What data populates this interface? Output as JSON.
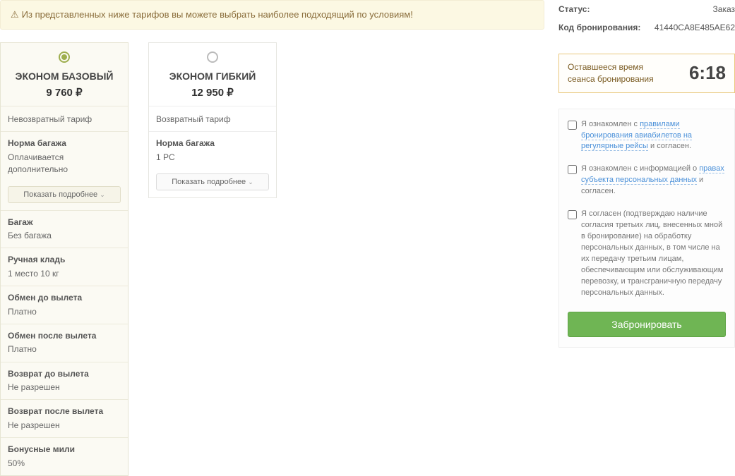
{
  "banner": {
    "text": "Из представленных ниже тарифов вы можете выбрать наиболее подходящий по условиям!"
  },
  "tariffs": {
    "show_more_label": "Показать подробнее",
    "basic": {
      "name": "ЭКОНОМ БАЗОВЫЙ",
      "price": "9 760",
      "currency": "₽",
      "refund_type": "Невозвратный тариф",
      "baggage_norm_label": "Норма багажа",
      "baggage_norm_value": "Оплачивается дополнительно",
      "baggage_label": "Багаж",
      "baggage_value": "Без багажа",
      "carry_label": "Ручная кладь",
      "carry_value": "1 место 10 кг",
      "exchange_before_label": "Обмен до вылета",
      "exchange_before_value": "Платно",
      "exchange_after_label": "Обмен после вылета",
      "exchange_after_value": "Платно",
      "refund_before_label": "Возврат до вылета",
      "refund_before_value": "Не разрешен",
      "refund_after_label": "Возврат после вылета",
      "refund_after_value": "Не разрешен",
      "miles_label": "Бонусные мили",
      "miles_value": "50%"
    },
    "flex": {
      "name": "ЭКОНОМ ГИБКИЙ",
      "price": "12 950",
      "currency": "₽",
      "refund_type": "Возвратный тариф",
      "baggage_norm_label": "Норма багажа",
      "baggage_norm_value": "1 PC"
    }
  },
  "sidebar": {
    "status_label": "Статус:",
    "status_value": "Заказ",
    "code_label": "Код бронирования:",
    "code_value": "41440CA8E485AE62",
    "timer_label": "Оставшееся время сеанса бронирования",
    "timer_value": "6:18",
    "agree1_pre": "Я ознакомлен с ",
    "agree1_link": "правилами бронирования авиабилетов на регулярные рейсы",
    "agree1_post": " и согласен.",
    "agree2_pre": "Я ознакомлен с информацией о ",
    "agree2_link": "правах субъекта персональных данных",
    "agree2_post": " и согласен.",
    "agree3": "Я согласен (подтверждаю наличие согласия третьих лиц, внесенных мной в бронирование) на обработку персональных данных, в том числе на их передачу третьим лицам, обеспечивающим или обслуживающим перевозку, и трансграничную передачу персональных данных.",
    "book_label": "Забронировать"
  }
}
